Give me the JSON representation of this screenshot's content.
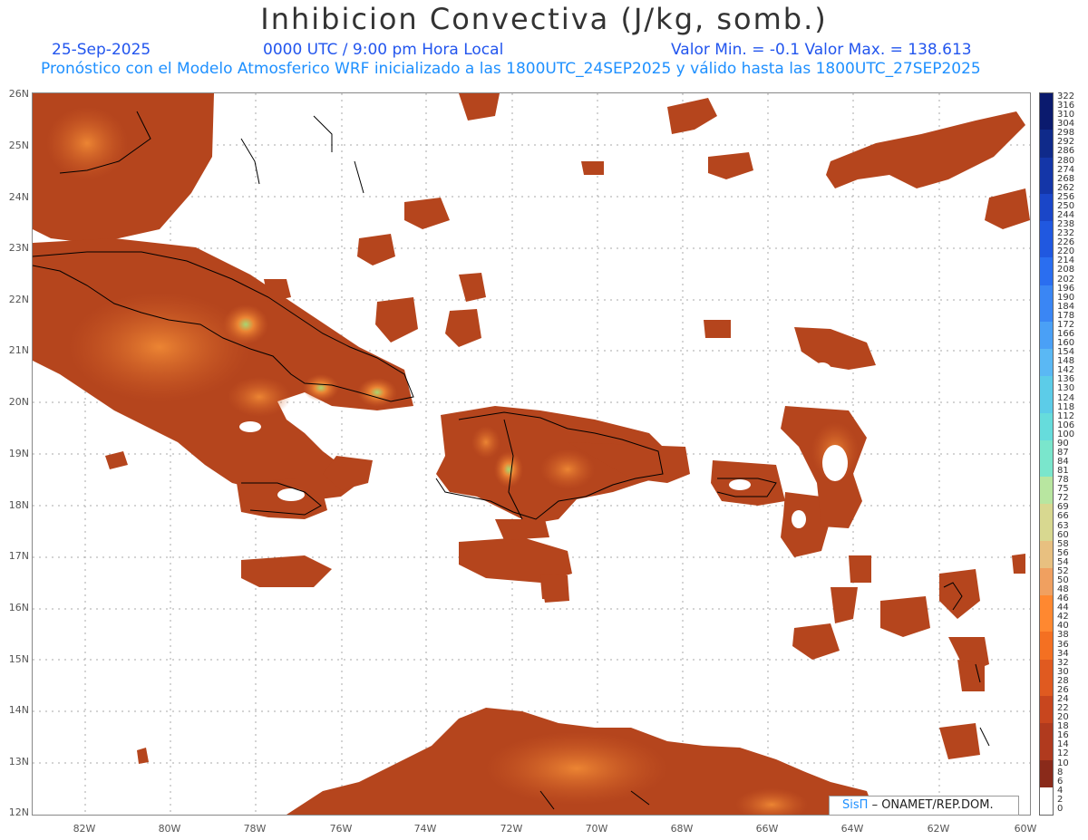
{
  "header": {
    "title": "Inhibicion Convectiva (J/kg, somb.)",
    "date": "25-Sep-2025",
    "time": "0000 UTC / 9:00 pm Hora Local",
    "minmax": "Valor Min. = -0.1  Valor Max. = 138.613",
    "model": "Pronóstico con el Modelo Atmosferico WRF inicializado a las 1800UTC_24SEP2025 y válido hasta las  1800UTC_27SEP2025"
  },
  "axes": {
    "lat_labels": [
      "26N",
      "25N",
      "24N",
      "23N",
      "22N",
      "21N",
      "20N",
      "19N",
      "18N",
      "17N",
      "16N",
      "15N",
      "14N",
      "13N",
      "12N"
    ],
    "lon_labels": [
      "82W",
      "80W",
      "78W",
      "76W",
      "74W",
      "72W",
      "70W",
      "68W",
      "66W",
      "64W",
      "62W",
      "60W"
    ],
    "lat_range": [
      12,
      26
    ],
    "lon_range": [
      -83.2,
      -60
    ]
  },
  "colorbar": {
    "labels": [
      "322",
      "316",
      "310",
      "304",
      "298",
      "292",
      "286",
      "280",
      "274",
      "268",
      "262",
      "256",
      "250",
      "244",
      "238",
      "232",
      "226",
      "220",
      "214",
      "208",
      "202",
      "196",
      "190",
      "184",
      "178",
      "172",
      "166",
      "160",
      "154",
      "148",
      "142",
      "136",
      "130",
      "124",
      "118",
      "112",
      "106",
      "100",
      "90",
      "87",
      "84",
      "81",
      "78",
      "75",
      "72",
      "69",
      "66",
      "63",
      "60",
      "58",
      "56",
      "54",
      "52",
      "50",
      "48",
      "46",
      "44",
      "42",
      "40",
      "38",
      "36",
      "34",
      "32",
      "30",
      "28",
      "26",
      "24",
      "22",
      "20",
      "18",
      "16",
      "14",
      "12",
      "10",
      "8",
      "6",
      "4",
      "2",
      "0"
    ],
    "colors": [
      "#0a1a6e",
      "#0f2a8a",
      "#1436a8",
      "#1a46c8",
      "#2058e0",
      "#2a6ef0",
      "#3a86f4",
      "#4aa0f6",
      "#5ab8f4",
      "#5ccce8",
      "#66dcdc",
      "#7ae6cc",
      "#b8e6a0",
      "#d8d890",
      "#e8c080",
      "#f0a060",
      "#ff8830",
      "#f47022",
      "#e05a20",
      "#c8461e",
      "#b03a1e",
      "#8a2a1a",
      "#ffffff"
    ]
  },
  "credit": {
    "sis": "SisΠ",
    "org": "– ONAMET/REP.DOM."
  },
  "field_colors": {
    "base": "#b5451d",
    "mid": "#cf5d27",
    "high": "#ec8533",
    "peak": "#a8d672"
  }
}
